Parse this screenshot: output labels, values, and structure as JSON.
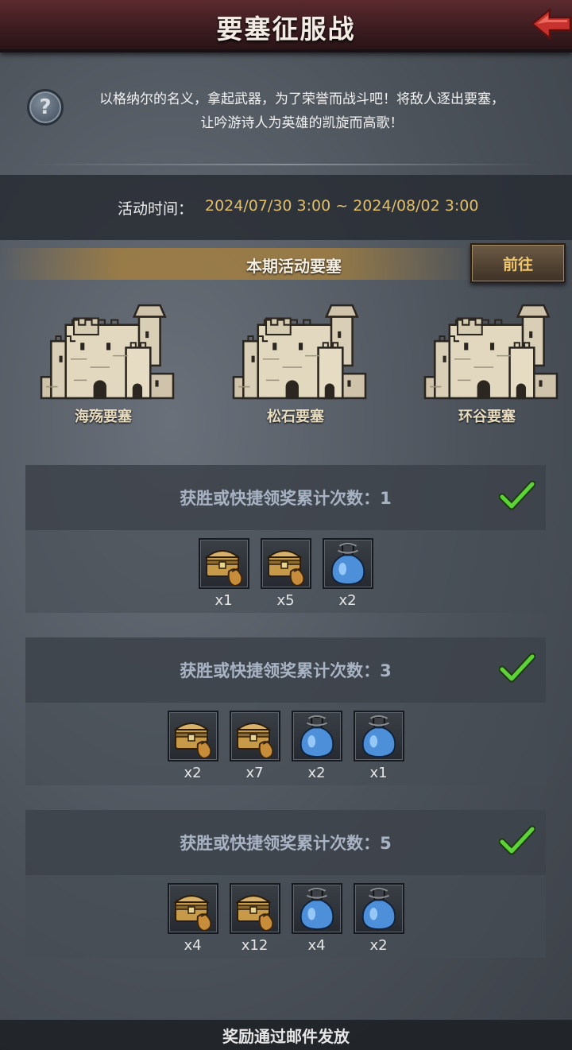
{
  "header": {
    "title": "要塞征服战",
    "back_icon": "red-arrow-back-icon"
  },
  "intro": {
    "help_symbol": "?",
    "line1": "以格纳尔的名义，拿起武器，为了荣誉而战斗吧！将敌人逐出要塞，",
    "line2": "让吟游诗人为英雄的凯旋而高歌！"
  },
  "event_time": {
    "label": "活动时间：",
    "value": "2024/07/30 3:00 ~ 2024/08/02 3:00"
  },
  "fortress_section": {
    "title": "本期活动要塞",
    "goto_label": "前往"
  },
  "fortresses": [
    {
      "name": "海殇要塞"
    },
    {
      "name": "松石要塞"
    },
    {
      "name": "环谷要塞"
    }
  ],
  "reward_tiers": [
    {
      "title": "获胜或快捷领奖累计次数：1",
      "claimed": true,
      "items": [
        {
          "icon": "treasure-chest-icon",
          "count": "x1"
        },
        {
          "icon": "treasure-chest-icon",
          "count": "x5"
        },
        {
          "icon": "blue-potion-icon",
          "count": "x2"
        }
      ]
    },
    {
      "title": "获胜或快捷领奖累计次数：3",
      "claimed": true,
      "items": [
        {
          "icon": "treasure-chest-icon",
          "count": "x2"
        },
        {
          "icon": "treasure-chest-icon",
          "count": "x7"
        },
        {
          "icon": "blue-potion-icon",
          "count": "x2"
        },
        {
          "icon": "blue-potion-icon",
          "count": "x1"
        }
      ]
    },
    {
      "title": "获胜或快捷领奖累计次数：5",
      "claimed": true,
      "items": [
        {
          "icon": "treasure-chest-icon",
          "count": "x4"
        },
        {
          "icon": "treasure-chest-icon",
          "count": "x12"
        },
        {
          "icon": "blue-potion-icon",
          "count": "x4"
        },
        {
          "icon": "blue-potion-icon",
          "count": "x2"
        }
      ]
    }
  ],
  "footer": {
    "note": "奖励通过邮件发放"
  },
  "colors": {
    "accent_gold": "#e0bf6c",
    "button_text": "#f0c66d",
    "check_green": "#5fd23a"
  }
}
